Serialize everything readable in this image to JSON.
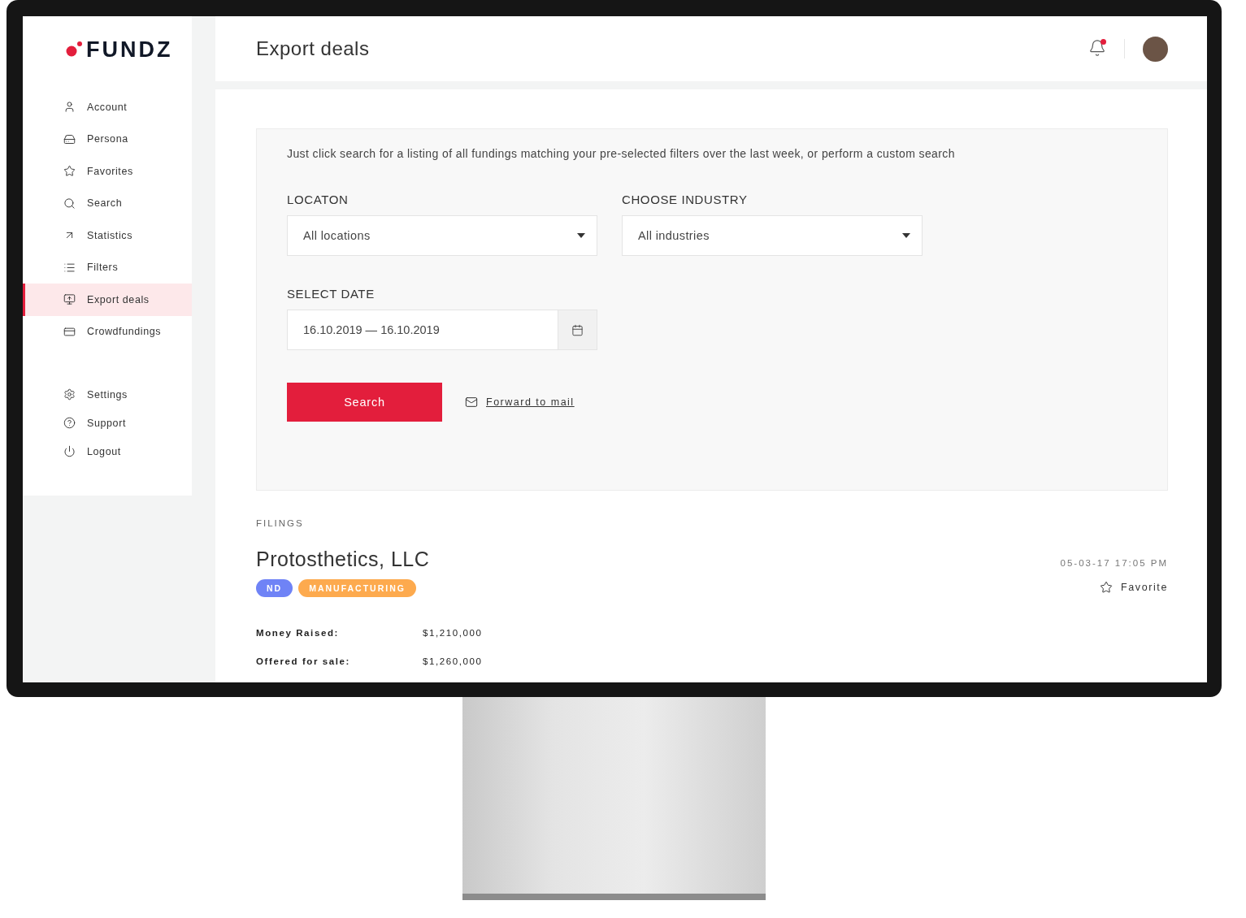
{
  "logo": "FUNDZ",
  "nav": [
    {
      "label": "Account",
      "selected": false
    },
    {
      "label": "Persona",
      "selected": false
    },
    {
      "label": "Favorites",
      "selected": false
    },
    {
      "label": "Search",
      "selected": false
    },
    {
      "label": "Statistics",
      "selected": false
    },
    {
      "label": "Filters",
      "selected": false
    },
    {
      "label": "Export deals",
      "selected": true
    },
    {
      "label": "Crowdfundings",
      "selected": false
    }
  ],
  "nav_bottom": [
    {
      "label": "Settings",
      "selected": false
    },
    {
      "label": "Support",
      "selected": false
    },
    {
      "label": "Logout",
      "selected": false
    }
  ],
  "header": {
    "title": "Export deals",
    "notification_unread": true
  },
  "search_panel": {
    "intro": "Just click search for a listing of all fundings matching your pre-selected filters over the last week, or perform a custom search",
    "location": {
      "label": "LOCATON",
      "value": "All locations"
    },
    "industry": {
      "label": "CHOOSE INDUSTRY",
      "value": "All industries"
    },
    "date": {
      "label": "SELECT DATE",
      "value": "16.10.2019 — 16.10.2019"
    },
    "search_button": "Search",
    "forward_link": "Forward to mail"
  },
  "filings": {
    "heading": "FILINGS",
    "items": [
      {
        "company": "Protosthetics, LLC",
        "timestamp": "05-03-17 17:05 PM",
        "favorite_label": "Favorite",
        "favorited": false,
        "tags": [
          {
            "label": "ND",
            "color": "#6f83f6"
          },
          {
            "label": "MANUFACTURING",
            "color": "#fdaa4e"
          }
        ],
        "facts": [
          {
            "label": "Money Raised:",
            "value": "$1,210,000"
          },
          {
            "label": "Offered for sale:",
            "value": "$1,260,000"
          }
        ]
      }
    ]
  }
}
